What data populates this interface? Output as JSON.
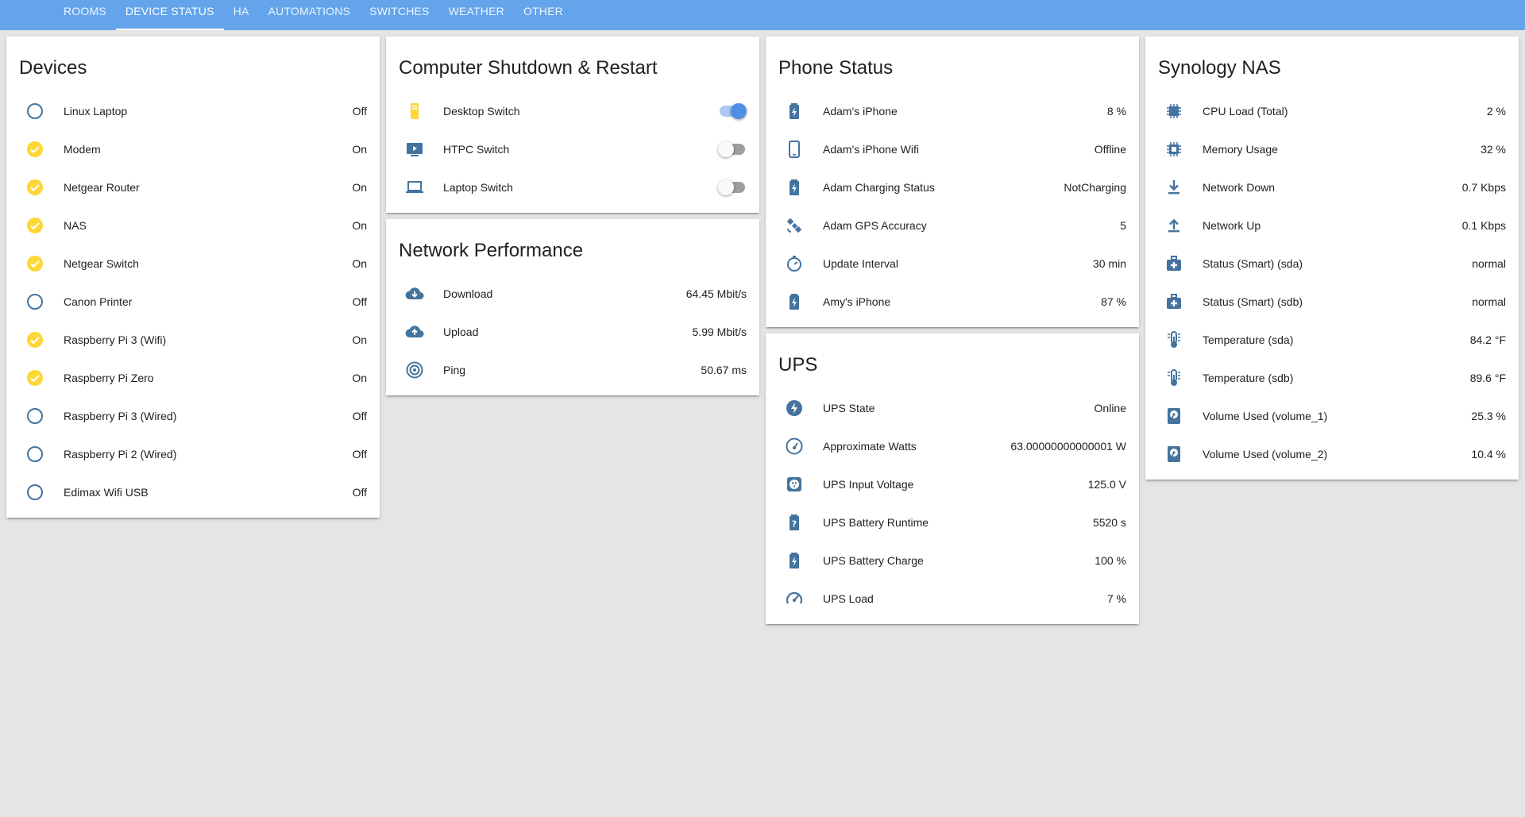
{
  "colors": {
    "topbar": "#63a4eb",
    "icon": "#44739e",
    "icon_on": "#fdd835",
    "toggle_on": "#4f8fe5"
  },
  "tabs": [
    {
      "label": "ROOMS",
      "active": false
    },
    {
      "label": "DEVICE STATUS",
      "active": true
    },
    {
      "label": "HA",
      "active": false
    },
    {
      "label": "AUTOMATIONS",
      "active": false
    },
    {
      "label": "SWITCHES",
      "active": false
    },
    {
      "label": "WEATHER",
      "active": false
    },
    {
      "label": "OTHER",
      "active": false
    }
  ],
  "devices": {
    "title": "Devices",
    "items": [
      {
        "label": "Linux Laptop",
        "value": "Off",
        "icon": "circle-outline-icon"
      },
      {
        "label": "Modem",
        "value": "On",
        "icon": "check-circle-icon"
      },
      {
        "label": "Netgear Router",
        "value": "On",
        "icon": "check-circle-icon"
      },
      {
        "label": "NAS",
        "value": "On",
        "icon": "check-circle-icon"
      },
      {
        "label": "Netgear Switch",
        "value": "On",
        "icon": "check-circle-icon"
      },
      {
        "label": "Canon Printer",
        "value": "Off",
        "icon": "circle-outline-icon"
      },
      {
        "label": "Raspberry Pi 3 (Wifi)",
        "value": "On",
        "icon": "check-circle-icon"
      },
      {
        "label": "Raspberry Pi Zero",
        "value": "On",
        "icon": "check-circle-icon"
      },
      {
        "label": "Raspberry Pi 3 (Wired)",
        "value": "Off",
        "icon": "circle-outline-icon"
      },
      {
        "label": "Raspberry Pi 2 (Wired)",
        "value": "Off",
        "icon": "circle-outline-icon"
      },
      {
        "label": "Edimax Wifi USB",
        "value": "Off",
        "icon": "circle-outline-icon"
      }
    ]
  },
  "computer": {
    "title": "Computer Shutdown & Restart",
    "items": [
      {
        "label": "Desktop Switch",
        "on": true,
        "icon": "desktop-tower-icon"
      },
      {
        "label": "HTPC Switch",
        "on": false,
        "icon": "television-play-icon"
      },
      {
        "label": "Laptop Switch",
        "on": false,
        "icon": "laptop-icon"
      }
    ]
  },
  "network": {
    "title": "Network Performance",
    "items": [
      {
        "label": "Download",
        "value": "64.45 Mbit/s",
        "icon": "cloud-download-icon"
      },
      {
        "label": "Upload",
        "value": "5.99 Mbit/s",
        "icon": "cloud-upload-icon"
      },
      {
        "label": "Ping",
        "value": "50.67 ms",
        "icon": "target-icon"
      }
    ]
  },
  "phone": {
    "title": "Phone Status",
    "items": [
      {
        "label": "Adam's iPhone",
        "value": "8 %",
        "icon": "battery-charging-icon"
      },
      {
        "label": "Adam's iPhone Wifi",
        "value": "Offline",
        "icon": "cellphone-icon"
      },
      {
        "label": "Adam Charging Status",
        "value": "NotCharging",
        "icon": "battery-charging-icon"
      },
      {
        "label": "Adam GPS Accuracy",
        "value": "5",
        "icon": "satellite-icon"
      },
      {
        "label": "Update Interval",
        "value": "30 min",
        "icon": "timer-icon"
      },
      {
        "label": "Amy's iPhone",
        "value": "87 %",
        "icon": "battery-charging-icon"
      }
    ]
  },
  "ups": {
    "title": "UPS",
    "items": [
      {
        "label": "UPS State",
        "value": "Online",
        "icon": "flash-circle-icon"
      },
      {
        "label": "Approximate Watts",
        "value": "63.00000000000001 W",
        "icon": "gauge-icon"
      },
      {
        "label": "UPS Input Voltage",
        "value": "125.0 V",
        "icon": "power-socket-icon"
      },
      {
        "label": "UPS Battery Runtime",
        "value": "5520 s",
        "icon": "battery-unknown-icon"
      },
      {
        "label": "UPS Battery Charge",
        "value": "100 %",
        "icon": "battery-charging-icon"
      },
      {
        "label": "UPS Load",
        "value": "7 %",
        "icon": "speedometer-icon"
      }
    ]
  },
  "nas": {
    "title": "Synology NAS",
    "items": [
      {
        "label": "CPU Load (Total)",
        "value": "2 %",
        "icon": "chip-icon"
      },
      {
        "label": "Memory Usage",
        "value": "32 %",
        "icon": "memory-icon"
      },
      {
        "label": "Network Down",
        "value": "0.7 Kbps",
        "icon": "download-icon"
      },
      {
        "label": "Network Up",
        "value": "0.1 Kbps",
        "icon": "upload-icon"
      },
      {
        "label": "Status (Smart) (sda)",
        "value": "normal",
        "icon": "medical-bag-icon"
      },
      {
        "label": "Status (Smart) (sdb)",
        "value": "normal",
        "icon": "medical-bag-icon"
      },
      {
        "label": "Temperature (sda)",
        "value": "84.2 °F",
        "icon": "thermometer-icon"
      },
      {
        "label": "Temperature (sdb)",
        "value": "89.6 °F",
        "icon": "thermometer-icon"
      },
      {
        "label": "Volume Used (volume_1)",
        "value": "25.3 %",
        "icon": "harddisk-icon"
      },
      {
        "label": "Volume Used (volume_2)",
        "value": "10.4 %",
        "icon": "harddisk-icon"
      }
    ]
  }
}
